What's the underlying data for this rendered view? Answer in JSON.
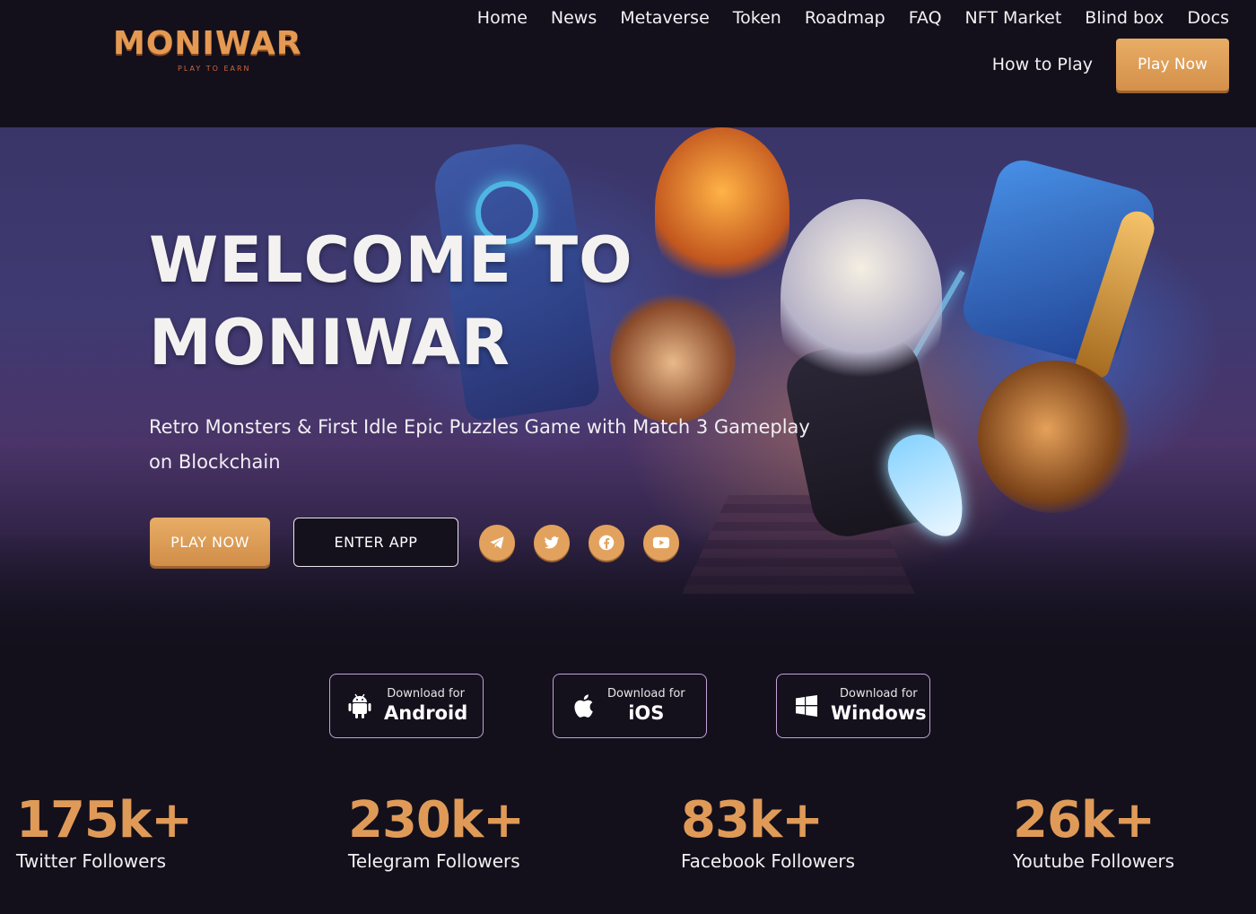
{
  "brand": {
    "name": "MONIWAR",
    "tagline": "PLAY TO EARN"
  },
  "nav": {
    "items": [
      "Home",
      "News",
      "Metaverse",
      "Token",
      "Roadmap",
      "FAQ",
      "NFT Market",
      "Blind box",
      "Docs"
    ],
    "how_to_play": "How to Play",
    "play_now": "Play Now"
  },
  "hero": {
    "title_line1": "WELCOME TO",
    "title_line2": "MONIWAR",
    "subtitle": "Retro Monsters & First Idle Epic Puzzles Game with Match 3 Gameplay on Blockchain",
    "play_button": "PLAY NOW",
    "enter_button": "ENTER APP",
    "socials": [
      "telegram-icon",
      "twitter-icon",
      "facebook-icon",
      "youtube-icon"
    ]
  },
  "downloads": [
    {
      "prefix": "Download for",
      "platform": "Android",
      "icon": "android-icon"
    },
    {
      "prefix": "Download for",
      "platform": "iOS",
      "icon": "apple-icon"
    },
    {
      "prefix": "Download for",
      "platform": "Windows",
      "icon": "windows-icon"
    }
  ],
  "stats": [
    {
      "value": "175k+",
      "label": "Twitter Followers"
    },
    {
      "value": "230k+",
      "label": "Telegram Followers"
    },
    {
      "value": "83k+",
      "label": "Facebook Followers"
    },
    {
      "value": "26k+",
      "label": "Youtube Followers"
    }
  ],
  "colors": {
    "accent": "#e09a58",
    "background": "#13101c",
    "button_gold": "#e8ad66"
  }
}
